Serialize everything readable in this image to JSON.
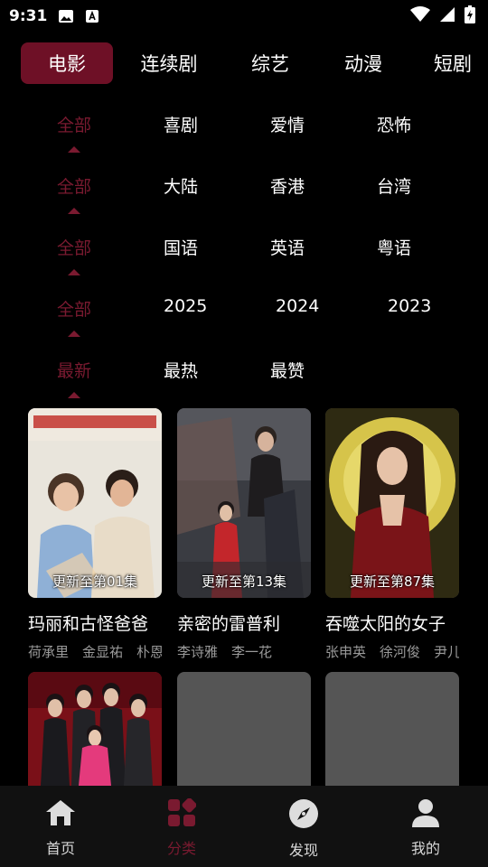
{
  "status_bar": {
    "time": "9:31"
  },
  "tabs": [
    {
      "label": "电影",
      "active": true
    },
    {
      "label": "连续剧"
    },
    {
      "label": "综艺"
    },
    {
      "label": "动漫"
    },
    {
      "label": "短剧"
    }
  ],
  "filters": [
    {
      "options": [
        "全部",
        "喜剧",
        "爱情",
        "恐怖"
      ],
      "selected": 0
    },
    {
      "options": [
        "全部",
        "大陆",
        "香港",
        "台湾"
      ],
      "selected": 0
    },
    {
      "options": [
        "全部",
        "国语",
        "英语",
        "粤语"
      ],
      "selected": 0
    },
    {
      "options": [
        "全部",
        "2025",
        "2024",
        "2023"
      ],
      "selected": 0
    },
    {
      "options": [
        "最新",
        "最热",
        "最赞"
      ],
      "selected": 0
    }
  ],
  "cards": [
    {
      "title": "玛丽和古怪爸爸",
      "cast": "荷承里　金显祐　朴恩…",
      "badge": "更新至第01集"
    },
    {
      "title": "亲密的雷普利",
      "cast": "李诗雅　李一花",
      "badge": "更新至第13集"
    },
    {
      "title": "吞噬太阳的女子",
      "cast": "张申英　徐河俊　尹儿…",
      "badge": "更新至第87集"
    },
    {
      "title": "",
      "cast": "",
      "badge": ""
    },
    {
      "title": "",
      "cast": "",
      "badge": ""
    },
    {
      "title": "",
      "cast": "",
      "badge": ""
    }
  ],
  "bottom_nav": [
    {
      "label": "首页",
      "icon": "home-icon"
    },
    {
      "label": "分类",
      "icon": "category-icon",
      "active": true
    },
    {
      "label": "发现",
      "icon": "compass-icon"
    },
    {
      "label": "我的",
      "icon": "user-icon"
    }
  ],
  "colors": {
    "accent": "#7a1a30",
    "tab_active_bg": "#6e1026",
    "background": "#000000"
  }
}
